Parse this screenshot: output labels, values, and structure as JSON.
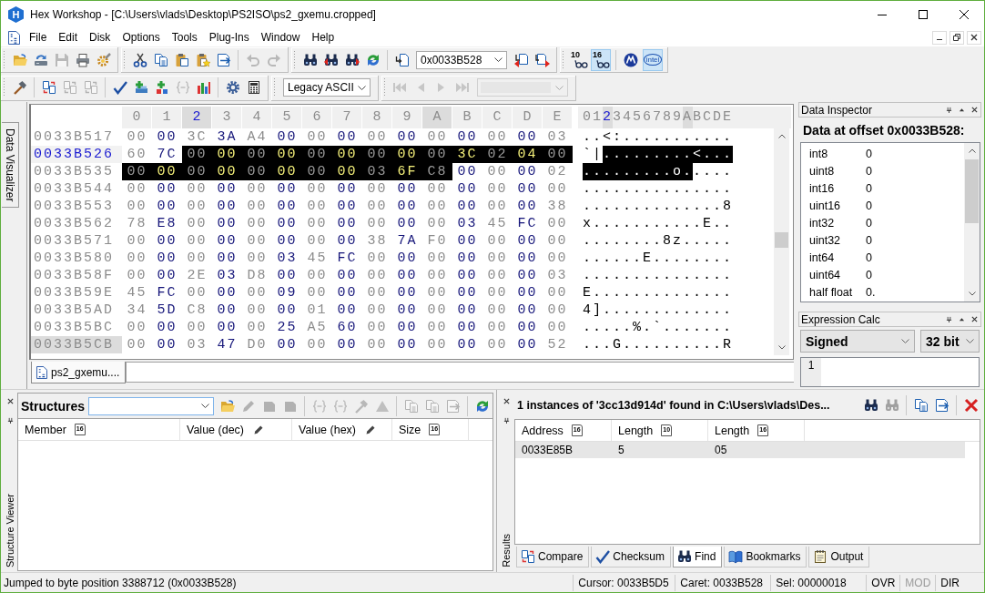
{
  "window": {
    "icon_letter": "H",
    "title": "Hex Workshop - [C:\\Users\\vlads\\Desktop\\PS2ISO\\ps2_gxemu.cropped]"
  },
  "menu": [
    "File",
    "Edit",
    "Disk",
    "Options",
    "Tools",
    "Plug-Ins",
    "Window",
    "Help"
  ],
  "toolbar_1": {
    "bands": [
      {
        "groups": [
          [
            {
              "kind": "open",
              "disabled": false
            },
            {
              "kind": "revert",
              "disabled": false
            },
            {
              "kind": "save",
              "disabled": true
            },
            {
              "kind": "print",
              "disabled": false
            },
            {
              "kind": "properties",
              "disabled": false
            }
          ]
        ]
      },
      {
        "groups": [
          [
            {
              "kind": "cut",
              "disabled": false
            },
            {
              "kind": "copy",
              "disabled": false
            },
            {
              "kind": "paste",
              "disabled": false
            },
            {
              "kind": "paste-special",
              "disabled": false
            },
            {
              "kind": "export",
              "disabled": false
            }
          ],
          [
            {
              "kind": "undo",
              "disabled": true
            },
            {
              "kind": "redo",
              "disabled": true
            }
          ]
        ]
      },
      {
        "groups": [
          [
            {
              "kind": "find",
              "disabled": false
            },
            {
              "kind": "find-prev",
              "disabled": false
            },
            {
              "kind": "find-next",
              "disabled": false
            },
            {
              "kind": "refresh",
              "disabled": false
            }
          ],
          [
            {
              "kind": "goto",
              "disabled": false
            },
            {
              "kind": "combo",
              "value": "0x0033B528",
              "disabled": false
            },
            {
              "kind": "goto-prev",
              "disabled": false
            },
            {
              "kind": "goto-next",
              "disabled": false
            }
          ]
        ]
      },
      {
        "groups": [
          [
            {
              "kind": "radix",
              "label": "10",
              "selected": false
            },
            {
              "kind": "radix",
              "label": "16",
              "selected": true
            }
          ],
          [
            {
              "kind": "logo-m",
              "selected": false
            },
            {
              "kind": "logo-text",
              "label": "intel",
              "selected": true
            }
          ]
        ]
      }
    ]
  },
  "toolbar_2": {
    "bands": [
      {
        "groups": [
          [
            {
              "kind": "hammer",
              "disabled": false
            }
          ],
          [
            {
              "kind": "compare",
              "disabled": false
            },
            {
              "kind": "compare",
              "disabled": true
            },
            {
              "kind": "compare",
              "disabled": true
            }
          ],
          [
            {
              "kind": "checksum",
              "disabled": false
            },
            {
              "kind": "add-struct",
              "disabled": false
            },
            {
              "kind": "add-group",
              "disabled": false
            },
            {
              "kind": "braces",
              "disabled": true
            },
            {
              "kind": "chart",
              "disabled": false
            }
          ],
          [
            {
              "kind": "gear",
              "disabled": false
            },
            {
              "kind": "calculator",
              "disabled": false
            }
          ]
        ]
      },
      {
        "groups": [
          [
            {
              "kind": "combo",
              "value": "Legacy ASCII",
              "disabled": false
            }
          ]
        ]
      },
      {
        "groups": [
          [
            {
              "kind": "nav-first",
              "disabled": true
            },
            {
              "kind": "nav-prev",
              "disabled": true
            },
            {
              "kind": "nav-next",
              "disabled": true
            },
            {
              "kind": "nav-last",
              "disabled": true
            },
            {
              "kind": "combo",
              "disabled": true
            }
          ]
        ]
      }
    ]
  },
  "side_tabs": [
    {
      "label": "Data Visualizer"
    }
  ],
  "hex_view": {
    "columns": [
      {
        "label": "0",
        "ascii_label": "0",
        "caret": false,
        "cursor": false
      },
      {
        "label": "1",
        "ascii_label": "1",
        "caret": false,
        "cursor": false
      },
      {
        "label": "2",
        "ascii_label": "2",
        "caret": true,
        "cursor": false
      },
      {
        "label": "3",
        "ascii_label": "3",
        "caret": false,
        "cursor": false
      },
      {
        "label": "4",
        "ascii_label": "4",
        "caret": false,
        "cursor": false
      },
      {
        "label": "5",
        "ascii_label": "5",
        "caret": false,
        "cursor": false
      },
      {
        "label": "6",
        "ascii_label": "6",
        "caret": false,
        "cursor": false
      },
      {
        "label": "7",
        "ascii_label": "7",
        "caret": false,
        "cursor": false
      },
      {
        "label": "8",
        "ascii_label": "8",
        "caret": false,
        "cursor": false
      },
      {
        "label": "9",
        "ascii_label": "9",
        "caret": false,
        "cursor": false
      },
      {
        "label": "A",
        "ascii_label": "A",
        "caret": false,
        "cursor": true
      },
      {
        "label": "B",
        "ascii_label": "B",
        "caret": false,
        "cursor": false
      },
      {
        "label": "C",
        "ascii_label": "C",
        "caret": false,
        "cursor": false
      },
      {
        "label": "D",
        "ascii_label": "D",
        "caret": false,
        "cursor": false
      },
      {
        "label": "E",
        "ascii_label": "E",
        "caret": false,
        "cursor": false
      }
    ],
    "rows": [
      {
        "address": "0033B517",
        "caret": false,
        "cursor": false,
        "bytes": [
          {
            "value": "00",
            "selected": false
          },
          {
            "value": "00",
            "selected": false
          },
          {
            "value": "3C",
            "selected": false
          },
          {
            "value": "3A",
            "selected": false
          },
          {
            "value": "A4",
            "selected": false
          },
          {
            "value": "00",
            "selected": false
          },
          {
            "value": "00",
            "selected": false
          },
          {
            "value": "00",
            "selected": false
          },
          {
            "value": "00",
            "selected": false
          },
          {
            "value": "00",
            "selected": false
          },
          {
            "value": "00",
            "selected": false
          },
          {
            "value": "00",
            "selected": false
          },
          {
            "value": "00",
            "selected": false
          },
          {
            "value": "00",
            "selected": false
          },
          {
            "value": "03",
            "selected": false
          }
        ],
        "ascii": [
          {
            "text": "..<:...........",
            "selected": false
          }
        ]
      },
      {
        "address": "0033B526",
        "caret": true,
        "cursor": false,
        "bytes": [
          {
            "value": "60",
            "selected": false
          },
          {
            "value": "7C",
            "selected": false
          },
          {
            "value": "00",
            "selected": true
          },
          {
            "value": "00",
            "selected": true
          },
          {
            "value": "00",
            "selected": true
          },
          {
            "value": "00",
            "selected": true
          },
          {
            "value": "00",
            "selected": true
          },
          {
            "value": "00",
            "selected": true
          },
          {
            "value": "00",
            "selected": true
          },
          {
            "value": "00",
            "selected": true
          },
          {
            "value": "00",
            "selected": true
          },
          {
            "value": "3C",
            "selected": true
          },
          {
            "value": "02",
            "selected": true
          },
          {
            "value": "04",
            "selected": true
          },
          {
            "value": "00",
            "selected": true
          }
        ],
        "ascii": [
          {
            "text": "`|",
            "selected": false
          },
          {
            "text": ".........<...",
            "selected": true
          }
        ]
      },
      {
        "address": "0033B535",
        "caret": false,
        "cursor": false,
        "bytes": [
          {
            "value": "00",
            "selected": true
          },
          {
            "value": "00",
            "selected": true
          },
          {
            "value": "00",
            "selected": true
          },
          {
            "value": "00",
            "selected": true
          },
          {
            "value": "00",
            "selected": true
          },
          {
            "value": "00",
            "selected": true
          },
          {
            "value": "00",
            "selected": true
          },
          {
            "value": "00",
            "selected": true
          },
          {
            "value": "03",
            "selected": true
          },
          {
            "value": "6F",
            "selected": true
          },
          {
            "value": "C8",
            "selected": true
          },
          {
            "value": "00",
            "selected": false
          },
          {
            "value": "00",
            "selected": false
          },
          {
            "value": "00",
            "selected": false
          },
          {
            "value": "02",
            "selected": false
          }
        ],
        "ascii": [
          {
            "text": ".........o.",
            "selected": true
          },
          {
            "text": "....",
            "selected": false
          }
        ]
      },
      {
        "address": "0033B544",
        "caret": false,
        "cursor": false,
        "bytes": [
          {
            "value": "00",
            "selected": false
          },
          {
            "value": "00",
            "selected": false
          },
          {
            "value": "00",
            "selected": false
          },
          {
            "value": "00",
            "selected": false
          },
          {
            "value": "00",
            "selected": false
          },
          {
            "value": "00",
            "selected": false
          },
          {
            "value": "00",
            "selected": false
          },
          {
            "value": "00",
            "selected": false
          },
          {
            "value": "00",
            "selected": false
          },
          {
            "value": "00",
            "selected": false
          },
          {
            "value": "00",
            "selected": false
          },
          {
            "value": "00",
            "selected": false
          },
          {
            "value": "00",
            "selected": false
          },
          {
            "value": "00",
            "selected": false
          },
          {
            "value": "00",
            "selected": false
          }
        ],
        "ascii": [
          {
            "text": "...............",
            "selected": false
          }
        ]
      },
      {
        "address": "0033B553",
        "caret": false,
        "cursor": false,
        "bytes": [
          {
            "value": "00",
            "selected": false
          },
          {
            "value": "00",
            "selected": false
          },
          {
            "value": "00",
            "selected": false
          },
          {
            "value": "00",
            "selected": false
          },
          {
            "value": "00",
            "selected": false
          },
          {
            "value": "00",
            "selected": false
          },
          {
            "value": "00",
            "selected": false
          },
          {
            "value": "00",
            "selected": false
          },
          {
            "value": "00",
            "selected": false
          },
          {
            "value": "00",
            "selected": false
          },
          {
            "value": "00",
            "selected": false
          },
          {
            "value": "00",
            "selected": false
          },
          {
            "value": "00",
            "selected": false
          },
          {
            "value": "00",
            "selected": false
          },
          {
            "value": "38",
            "selected": false
          }
        ],
        "ascii": [
          {
            "text": "..............8",
            "selected": false
          }
        ]
      },
      {
        "address": "0033B562",
        "caret": false,
        "cursor": false,
        "bytes": [
          {
            "value": "78",
            "selected": false
          },
          {
            "value": "E8",
            "selected": false
          },
          {
            "value": "00",
            "selected": false
          },
          {
            "value": "00",
            "selected": false
          },
          {
            "value": "00",
            "selected": false
          },
          {
            "value": "00",
            "selected": false
          },
          {
            "value": "00",
            "selected": false
          },
          {
            "value": "00",
            "selected": false
          },
          {
            "value": "00",
            "selected": false
          },
          {
            "value": "00",
            "selected": false
          },
          {
            "value": "00",
            "selected": false
          },
          {
            "value": "03",
            "selected": false
          },
          {
            "value": "45",
            "selected": false
          },
          {
            "value": "FC",
            "selected": false
          },
          {
            "value": "00",
            "selected": false
          }
        ],
        "ascii": [
          {
            "text": "x...........E..",
            "selected": false
          }
        ]
      },
      {
        "address": "0033B571",
        "caret": false,
        "cursor": false,
        "bytes": [
          {
            "value": "00",
            "selected": false
          },
          {
            "value": "00",
            "selected": false
          },
          {
            "value": "00",
            "selected": false
          },
          {
            "value": "00",
            "selected": false
          },
          {
            "value": "00",
            "selected": false
          },
          {
            "value": "00",
            "selected": false
          },
          {
            "value": "00",
            "selected": false
          },
          {
            "value": "00",
            "selected": false
          },
          {
            "value": "38",
            "selected": false
          },
          {
            "value": "7A",
            "selected": false
          },
          {
            "value": "F0",
            "selected": false
          },
          {
            "value": "00",
            "selected": false
          },
          {
            "value": "00",
            "selected": false
          },
          {
            "value": "00",
            "selected": false
          },
          {
            "value": "00",
            "selected": false
          }
        ],
        "ascii": [
          {
            "text": "........8z.....",
            "selected": false
          }
        ]
      },
      {
        "address": "0033B580",
        "caret": false,
        "cursor": false,
        "bytes": [
          {
            "value": "00",
            "selected": false
          },
          {
            "value": "00",
            "selected": false
          },
          {
            "value": "00",
            "selected": false
          },
          {
            "value": "00",
            "selected": false
          },
          {
            "value": "00",
            "selected": false
          },
          {
            "value": "03",
            "selected": false
          },
          {
            "value": "45",
            "selected": false
          },
          {
            "value": "FC",
            "selected": false
          },
          {
            "value": "00",
            "selected": false
          },
          {
            "value": "00",
            "selected": false
          },
          {
            "value": "00",
            "selected": false
          },
          {
            "value": "00",
            "selected": false
          },
          {
            "value": "00",
            "selected": false
          },
          {
            "value": "00",
            "selected": false
          },
          {
            "value": "00",
            "selected": false
          }
        ],
        "ascii": [
          {
            "text": "......E........",
            "selected": false
          }
        ]
      },
      {
        "address": "0033B58F",
        "caret": false,
        "cursor": false,
        "bytes": [
          {
            "value": "00",
            "selected": false
          },
          {
            "value": "00",
            "selected": false
          },
          {
            "value": "2E",
            "selected": false
          },
          {
            "value": "03",
            "selected": false
          },
          {
            "value": "D8",
            "selected": false
          },
          {
            "value": "00",
            "selected": false
          },
          {
            "value": "00",
            "selected": false
          },
          {
            "value": "00",
            "selected": false
          },
          {
            "value": "00",
            "selected": false
          },
          {
            "value": "00",
            "selected": false
          },
          {
            "value": "00",
            "selected": false
          },
          {
            "value": "00",
            "selected": false
          },
          {
            "value": "00",
            "selected": false
          },
          {
            "value": "00",
            "selected": false
          },
          {
            "value": "03",
            "selected": false
          }
        ],
        "ascii": [
          {
            "text": "...............",
            "selected": false
          }
        ]
      },
      {
        "address": "0033B59E",
        "caret": false,
        "cursor": false,
        "bytes": [
          {
            "value": "45",
            "selected": false
          },
          {
            "value": "FC",
            "selected": false
          },
          {
            "value": "00",
            "selected": false
          },
          {
            "value": "00",
            "selected": false
          },
          {
            "value": "00",
            "selected": false
          },
          {
            "value": "09",
            "selected": false
          },
          {
            "value": "00",
            "selected": false
          },
          {
            "value": "00",
            "selected": false
          },
          {
            "value": "00",
            "selected": false
          },
          {
            "value": "00",
            "selected": false
          },
          {
            "value": "00",
            "selected": false
          },
          {
            "value": "00",
            "selected": false
          },
          {
            "value": "00",
            "selected": false
          },
          {
            "value": "00",
            "selected": false
          },
          {
            "value": "00",
            "selected": false
          }
        ],
        "ascii": [
          {
            "text": "E..............",
            "selected": false
          }
        ]
      },
      {
        "address": "0033B5AD",
        "caret": false,
        "cursor": false,
        "bytes": [
          {
            "value": "34",
            "selected": false
          },
          {
            "value": "5D",
            "selected": false
          },
          {
            "value": "C8",
            "selected": false
          },
          {
            "value": "00",
            "selected": false
          },
          {
            "value": "00",
            "selected": false
          },
          {
            "value": "00",
            "selected": false
          },
          {
            "value": "01",
            "selected": false
          },
          {
            "value": "00",
            "selected": false
          },
          {
            "value": "00",
            "selected": false
          },
          {
            "value": "00",
            "selected": false
          },
          {
            "value": "00",
            "selected": false
          },
          {
            "value": "00",
            "selected": false
          },
          {
            "value": "00",
            "selected": false
          },
          {
            "value": "00",
            "selected": false
          },
          {
            "value": "00",
            "selected": false
          }
        ],
        "ascii": [
          {
            "text": "4].............",
            "selected": false
          }
        ]
      },
      {
        "address": "0033B5BC",
        "caret": false,
        "cursor": false,
        "bytes": [
          {
            "value": "00",
            "selected": false
          },
          {
            "value": "00",
            "selected": false
          },
          {
            "value": "00",
            "selected": false
          },
          {
            "value": "00",
            "selected": false
          },
          {
            "value": "00",
            "selected": false
          },
          {
            "value": "25",
            "selected": false
          },
          {
            "value": "A5",
            "selected": false
          },
          {
            "value": "60",
            "selected": false
          },
          {
            "value": "00",
            "selected": false
          },
          {
            "value": "00",
            "selected": false
          },
          {
            "value": "00",
            "selected": false
          },
          {
            "value": "00",
            "selected": false
          },
          {
            "value": "00",
            "selected": false
          },
          {
            "value": "00",
            "selected": false
          },
          {
            "value": "00",
            "selected": false
          }
        ],
        "ascii": [
          {
            "text": ".....%.`.......",
            "selected": false
          }
        ]
      },
      {
        "address": "0033B5CB",
        "caret": false,
        "cursor": true,
        "bytes": [
          {
            "value": "00",
            "selected": false
          },
          {
            "value": "00",
            "selected": false
          },
          {
            "value": "03",
            "selected": false
          },
          {
            "value": "47",
            "selected": false
          },
          {
            "value": "D0",
            "selected": false
          },
          {
            "value": "00",
            "selected": false
          },
          {
            "value": "00",
            "selected": false
          },
          {
            "value": "00",
            "selected": false
          },
          {
            "value": "00",
            "selected": false
          },
          {
            "value": "00",
            "selected": false
          },
          {
            "value": "00",
            "selected": false
          },
          {
            "value": "00",
            "selected": false
          },
          {
            "value": "00",
            "selected": false
          },
          {
            "value": "00",
            "selected": false
          },
          {
            "value": "52",
            "selected": false
          }
        ],
        "ascii": [
          {
            "text": "...G..........R",
            "selected": false
          }
        ]
      }
    ],
    "file_tabs": [
      {
        "label": "ps2_gxemu....",
        "selected": true
      }
    ]
  },
  "data_inspector": {
    "title": "Data Inspector",
    "heading": "Data at offset 0x0033B528:",
    "rows": [
      {
        "type": "int8",
        "value": "0"
      },
      {
        "type": "uint8",
        "value": "0"
      },
      {
        "type": "int16",
        "value": "0"
      },
      {
        "type": "uint16",
        "value": "0"
      },
      {
        "type": "int32",
        "value": "0"
      },
      {
        "type": "uint32",
        "value": "0"
      },
      {
        "type": "int64",
        "value": "0"
      },
      {
        "type": "uint64",
        "value": "0"
      },
      {
        "type": "half float",
        "value": "0."
      }
    ]
  },
  "expression_calc": {
    "title": "Expression Calc",
    "sign_mode": "Signed",
    "bit_width": "32 bit",
    "lines": [
      "1"
    ]
  },
  "structure_viewer": {
    "side_label": "Structure Viewer",
    "title": "Structures",
    "tools": [
      [
        {
          "kind": "open",
          "disabled": false
        },
        {
          "kind": "pencil",
          "disabled": true
        },
        {
          "kind": "tile",
          "disabled": true
        },
        {
          "kind": "tile",
          "disabled": true
        }
      ],
      [
        {
          "kind": "braces",
          "disabled": true
        },
        {
          "kind": "braces",
          "disabled": true
        },
        {
          "kind": "hammer",
          "disabled": true
        },
        {
          "kind": "triangle",
          "disabled": true
        }
      ],
      [
        {
          "kind": "copy",
          "disabled": true
        },
        {
          "kind": "copy",
          "disabled": true
        },
        {
          "kind": "export",
          "disabled": true
        }
      ],
      [
        {
          "kind": "refresh",
          "disabled": false
        }
      ]
    ],
    "columns": [
      {
        "label": "Member",
        "kind": "radix",
        "radix": "16"
      },
      {
        "label": "Value (dec)",
        "kind": "edit"
      },
      {
        "label": "Value (hex)",
        "kind": "edit"
      },
      {
        "label": "Size",
        "kind": "radix",
        "radix": "16"
      }
    ]
  },
  "results": {
    "side_label": "Results",
    "title": "1 instances of '3cc13d914d' found in C:\\Users\\vlads\\Des...",
    "tools": [
      [
        {
          "kind": "find",
          "disabled": false
        },
        {
          "kind": "find",
          "disabled": true
        }
      ],
      [
        {
          "kind": "copy",
          "disabled": false
        },
        {
          "kind": "export",
          "disabled": false
        }
      ],
      [
        {
          "kind": "delete",
          "disabled": false
        }
      ]
    ],
    "columns": [
      {
        "label": "Address",
        "kind": "radix",
        "radix": "16"
      },
      {
        "label": "Length",
        "kind": "radix",
        "radix": "10"
      },
      {
        "label": "Length",
        "kind": "radix",
        "radix": "16"
      }
    ],
    "rows": [
      {
        "cells": [
          "0033E85B",
          "5",
          "05"
        ],
        "selected": true
      }
    ],
    "tabs": [
      {
        "kind": "compare",
        "label": "Compare",
        "selected": false
      },
      {
        "kind": "checksum",
        "label": "Checksum",
        "selected": false
      },
      {
        "kind": "find",
        "label": "Find",
        "selected": true
      },
      {
        "kind": "bookmarks",
        "label": "Bookmarks",
        "selected": false
      },
      {
        "kind": "output",
        "label": "Output",
        "selected": false
      }
    ]
  },
  "status_bar": {
    "message": "Jumped to byte position 3388712 (0x0033B528)",
    "fields": [
      "Cursor: 0033B5D5",
      "Caret: 0033B528",
      "Sel: 00000018"
    ],
    "indicators": [
      {
        "label": "OVR",
        "active": true
      },
      {
        "label": "MOD",
        "active": false
      },
      {
        "label": "DIR",
        "active": true
      }
    ]
  }
}
